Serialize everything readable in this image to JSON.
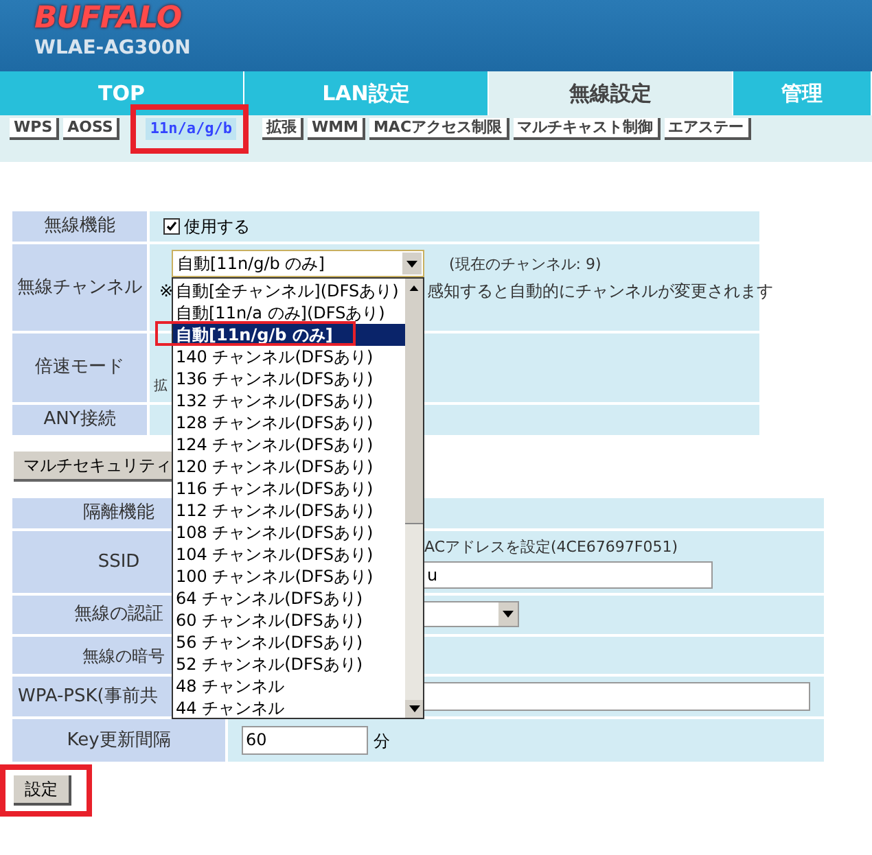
{
  "header": {
    "logo": "BUFFALO",
    "model": "WLAE-AG300N"
  },
  "main_tabs": [
    {
      "label": "TOP",
      "selected": false
    },
    {
      "label": "LAN設定",
      "selected": false
    },
    {
      "label": "無線設定",
      "selected": true
    },
    {
      "label": "管理",
      "selected": false
    }
  ],
  "sub_tabs": [
    {
      "label": "WPS",
      "selected": false
    },
    {
      "label": "AOSS",
      "selected": false
    },
    {
      "label": "11n/a/g/b",
      "selected": true
    },
    {
      "label": "拡張",
      "selected": false
    },
    {
      "label": "WMM",
      "selected": false
    },
    {
      "label": "MACアクセス制限",
      "selected": false
    },
    {
      "label": "マルチキャスト制御",
      "selected": false
    },
    {
      "label": "エアステー",
      "selected": false
    }
  ],
  "wireless_table": {
    "function_label": "無線機能",
    "function_checkbox": {
      "label": "使用する",
      "checked": true
    },
    "channel_label": "無線チャンネル",
    "current_channel": "(現在のチャンネル: 9)",
    "note_mark": "※",
    "note_text": "感知すると自動的にチャンネルが変更されます",
    "speed_label": "倍速モード",
    "speed_text": "拡",
    "any_label": "ANY接続"
  },
  "channel_select": {
    "value": "自動[11n/g/b のみ]",
    "options": [
      {
        "label": "自動[全チャンネル](DFSあり)",
        "selected": false
      },
      {
        "label": "自動[11n/a のみ](DFSあり)",
        "selected": false
      },
      {
        "label": "自動[11n/g/b のみ]",
        "selected": true
      },
      {
        "label": "140 チャンネル(DFSあり)",
        "selected": false
      },
      {
        "label": "136 チャンネル(DFSあり)",
        "selected": false
      },
      {
        "label": "132 チャンネル(DFSあり)",
        "selected": false
      },
      {
        "label": "128 チャンネル(DFSあり)",
        "selected": false
      },
      {
        "label": "124 チャンネル(DFSあり)",
        "selected": false
      },
      {
        "label": "120 チャンネル(DFSあり)",
        "selected": false
      },
      {
        "label": "116 チャンネル(DFSあり)",
        "selected": false
      },
      {
        "label": "112 チャンネル(DFSあり)",
        "selected": false
      },
      {
        "label": "108 チャンネル(DFSあり)",
        "selected": false
      },
      {
        "label": "104 チャンネル(DFSあり)",
        "selected": false
      },
      {
        "label": "100 チャンネル(DFSあり)",
        "selected": false
      },
      {
        "label": "64 チャンネル(DFSあり)",
        "selected": false
      },
      {
        "label": "60 チャンネル(DFSあり)",
        "selected": false
      },
      {
        "label": "56 チャンネル(DFSあり)",
        "selected": false
      },
      {
        "label": "52 チャンネル(DFSあり)",
        "selected": false
      },
      {
        "label": "48 チャンネル",
        "selected": false
      },
      {
        "label": "44 チャンネル",
        "selected": false
      }
    ]
  },
  "multi_security_button": "マルチセキュリティ",
  "security_table": {
    "isolation_label": "隔離機能",
    "ssid_label": "SSID",
    "ssid_note": "ACアドレスを設定(4CE67697F051)",
    "ssid_value": "u",
    "auth_label": "無線の認証",
    "encryption_label": "無線の暗号",
    "psk_label": "WPA-PSK(事前共",
    "key_label": "Key更新間隔",
    "key_value": "60",
    "key_unit": "分"
  },
  "submit_button": "設定"
}
